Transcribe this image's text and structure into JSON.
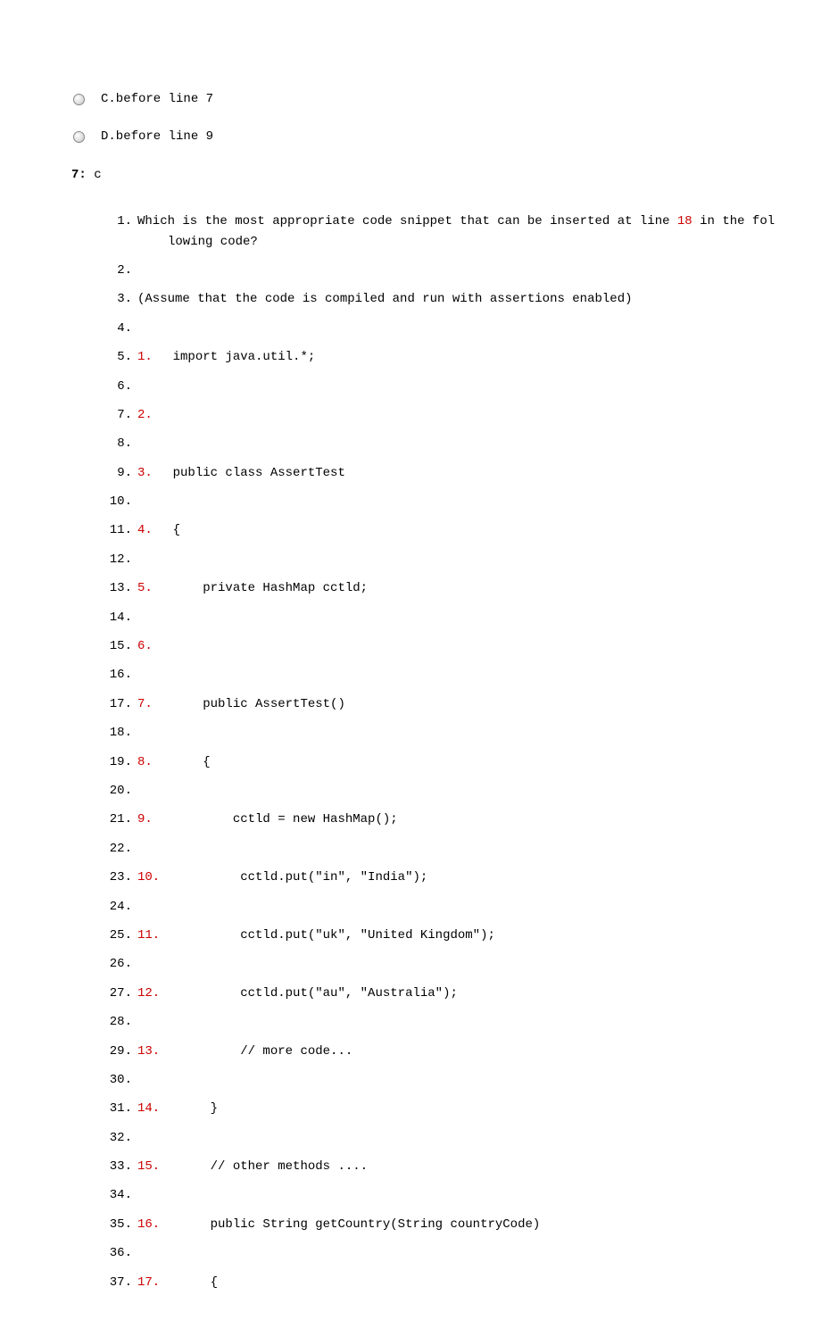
{
  "options": {
    "c": "C.before line 7",
    "d": "D.before line 9"
  },
  "question": {
    "number": "7:",
    "answer": "c"
  },
  "code": {
    "q_line1_a": "Which is the most appropriate code snippet that can be inserted at line ",
    "q_line1_ref": "18",
    "q_line1_b": " in the fol",
    "q_line1_cont": "lowing code?",
    "q_line3": "(Assume that the code is compiled and run with assertions enabled)",
    "lines": [
      {
        "outer": "1.",
        "inner": "",
        "text": ""
      },
      {
        "outer": "2.",
        "inner": "",
        "text": ""
      },
      {
        "outer": "3.",
        "inner": "",
        "text": ""
      },
      {
        "outer": "4.",
        "inner": "",
        "text": ""
      },
      {
        "outer": "5.",
        "inner": "1.",
        "text": "  import java.util.*;"
      },
      {
        "outer": "6.",
        "inner": "",
        "text": ""
      },
      {
        "outer": "7.",
        "inner": "2.",
        "text": ""
      },
      {
        "outer": "8.",
        "inner": "",
        "text": ""
      },
      {
        "outer": "9.",
        "inner": "3.",
        "text": "  public class AssertTest"
      },
      {
        "outer": "10.",
        "inner": "",
        "text": ""
      },
      {
        "outer": "11.",
        "inner": "4.",
        "text": "  {"
      },
      {
        "outer": "12.",
        "inner": "",
        "text": ""
      },
      {
        "outer": "13.",
        "inner": "5.",
        "text": "      private HashMap cctld;"
      },
      {
        "outer": "14.",
        "inner": "",
        "text": ""
      },
      {
        "outer": "15.",
        "inner": "6.",
        "text": ""
      },
      {
        "outer": "16.",
        "inner": "",
        "text": ""
      },
      {
        "outer": "17.",
        "inner": "7.",
        "text": "      public AssertTest()"
      },
      {
        "outer": "18.",
        "inner": "",
        "text": ""
      },
      {
        "outer": "19.",
        "inner": "8.",
        "text": "      {"
      },
      {
        "outer": "20.",
        "inner": "",
        "text": ""
      },
      {
        "outer": "21.",
        "inner": "9.",
        "text": "          cctld = new HashMap();"
      },
      {
        "outer": "22.",
        "inner": "",
        "text": ""
      },
      {
        "outer": "23.",
        "inner": "10.",
        "text": "          cctld.put(\"in\", \"India\");"
      },
      {
        "outer": "24.",
        "inner": "",
        "text": ""
      },
      {
        "outer": "25.",
        "inner": "11.",
        "text": "          cctld.put(\"uk\", \"United Kingdom\");"
      },
      {
        "outer": "26.",
        "inner": "",
        "text": ""
      },
      {
        "outer": "27.",
        "inner": "12.",
        "text": "          cctld.put(\"au\", \"Australia\");"
      },
      {
        "outer": "28.",
        "inner": "",
        "text": ""
      },
      {
        "outer": "29.",
        "inner": "13.",
        "text": "          // more code..."
      },
      {
        "outer": "30.",
        "inner": "",
        "text": ""
      },
      {
        "outer": "31.",
        "inner": "14.",
        "text": "      }"
      },
      {
        "outer": "32.",
        "inner": "",
        "text": ""
      },
      {
        "outer": "33.",
        "inner": "15.",
        "text": "      // other methods ...."
      },
      {
        "outer": "34.",
        "inner": "",
        "text": ""
      },
      {
        "outer": "35.",
        "inner": "16.",
        "text": "      public String getCountry(String countryCode)"
      },
      {
        "outer": "36.",
        "inner": "",
        "text": ""
      },
      {
        "outer": "37.",
        "inner": "17.",
        "text": "      {"
      }
    ]
  }
}
